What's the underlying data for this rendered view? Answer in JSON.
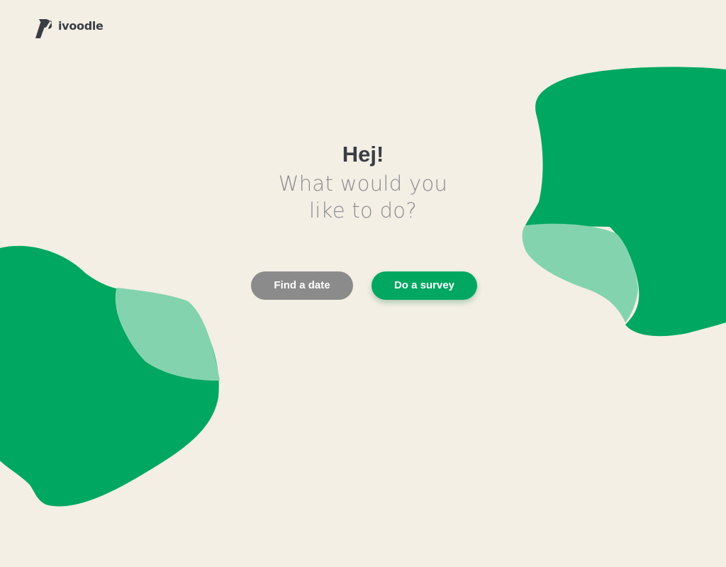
{
  "brand": {
    "name": "ivoodle",
    "logo_icon": "ivoodle-logo-icon"
  },
  "hero": {
    "greeting": "Hej!",
    "prompt_line1": "What would you",
    "prompt_line2": "like to do?"
  },
  "actions": {
    "find_date_label": "Find a date",
    "survey_label": "Do a survey"
  },
  "colors": {
    "background": "#f3efe5",
    "brand_green": "#00a760",
    "light_green": "#83d4ae",
    "secondary_gray": "#8b8b8b",
    "heading_text": "#3a3d44",
    "subtitle_text": "#8a8c90"
  }
}
